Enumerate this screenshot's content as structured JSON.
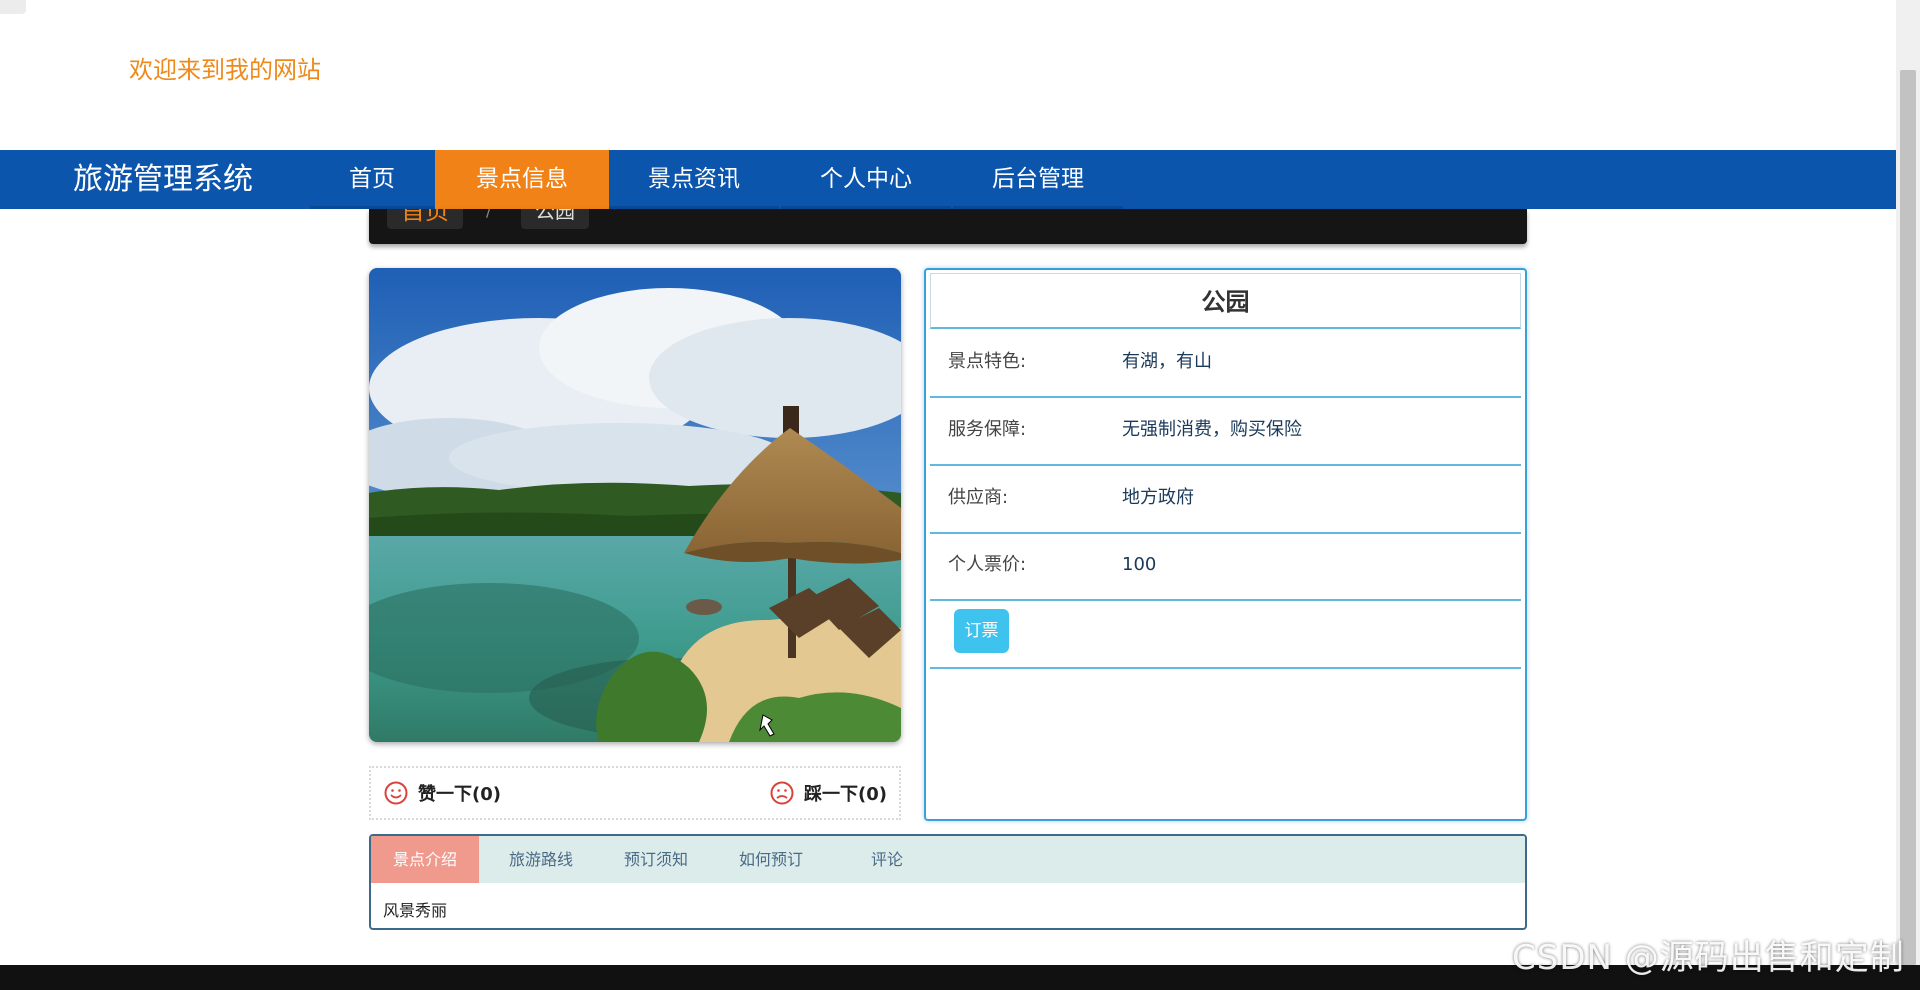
{
  "header": {
    "welcome": "欢迎来到我的网站"
  },
  "navbar": {
    "brand": "旅游管理系统",
    "items": [
      {
        "label": "首页"
      },
      {
        "label": "景点信息",
        "active": true
      },
      {
        "label": "景点资讯"
      },
      {
        "label": "个人中心"
      },
      {
        "label": "后台管理"
      }
    ]
  },
  "breadcrumb": {
    "home": "首页",
    "separator": "/",
    "current": "公园"
  },
  "attraction": {
    "name": "公园",
    "fields": [
      {
        "label": "景点特色:",
        "value": "有湖，有山"
      },
      {
        "label": "服务保障:",
        "value": "无强制消费，购买保险"
      },
      {
        "label": "供应商:",
        "value": "地方政府"
      },
      {
        "label": "个人票价:",
        "value": "100"
      }
    ],
    "book_button": "订票"
  },
  "votes": {
    "like": "赞一下(0)",
    "dislike": "踩一下(0)"
  },
  "tabs": {
    "items": [
      {
        "label": "景点介绍",
        "active": true
      },
      {
        "label": "旅游路线"
      },
      {
        "label": "预订须知"
      },
      {
        "label": "如何预订"
      },
      {
        "label": "评论"
      }
    ],
    "content": "风景秀丽"
  },
  "watermark": "CSDN @源码出售和定制",
  "colors": {
    "nav": "#0b55ad",
    "accent": "#f08217",
    "info_border": "#3ba0da",
    "book_button": "#3ec3ee",
    "active_tab": "#ef9a8c"
  }
}
